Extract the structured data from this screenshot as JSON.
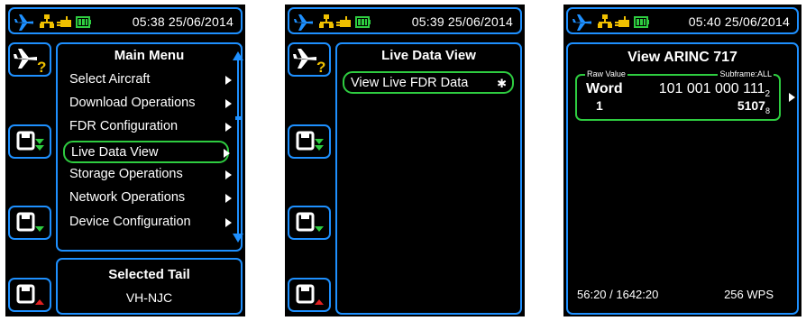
{
  "screen1": {
    "status": {
      "time": "05:38 25/06/2014"
    },
    "side_icons": [
      "aircraft-help-icon",
      "download-icon",
      "save-icon",
      "upload-icon"
    ],
    "main_menu": {
      "title": "Main Menu",
      "items": [
        {
          "label": "Select Aircraft"
        },
        {
          "label": "Download Operations"
        },
        {
          "label": "FDR Configuration"
        },
        {
          "label": "Live Data View",
          "selected": true
        },
        {
          "label": "Storage Operations"
        },
        {
          "label": "Network Operations"
        },
        {
          "label": "Device Configuration"
        }
      ]
    },
    "selected_tail": {
      "title": "Selected Tail",
      "value": "VH-NJC"
    }
  },
  "screen2": {
    "status": {
      "time": "05:39 25/06/2014"
    },
    "panel": {
      "title": "Live Data View",
      "item_label": "View Live FDR Data"
    }
  },
  "screen3": {
    "status": {
      "time": "05:40 25/06/2014"
    },
    "title": "View ARINC 717",
    "raw_value_label": "Raw Value",
    "subframe_label": "Subframe:ALL",
    "word_label": "Word",
    "word_number": "1",
    "binary_value": "101 001 000 111",
    "binary_sub": "2",
    "octal_value": "5107",
    "octal_sub": "8",
    "footer_time": "56:20 / 1642:20",
    "footer_wps": "256 WPS"
  },
  "colors": {
    "accent": "#1e90ff",
    "highlight": "#2ecc40",
    "down": "#2ecc40",
    "up": "#e02020",
    "battery": "#2ecc40",
    "network": "#f0c000"
  }
}
